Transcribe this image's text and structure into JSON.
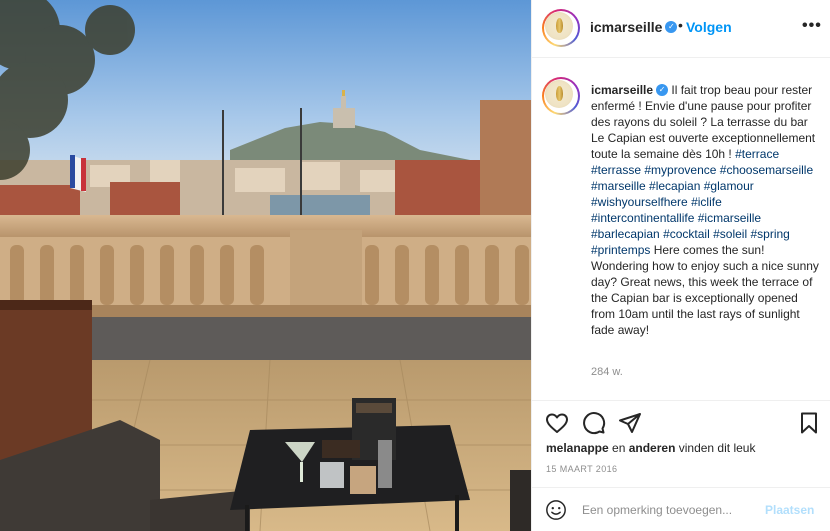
{
  "post": {
    "username": "icmarseille",
    "verified": true,
    "follow_separator": "•",
    "follow_label": "Volgen",
    "more_label": "•••"
  },
  "caption": {
    "username": "icmarseille",
    "segments": [
      {
        "type": "text",
        "value": " Il fait trop beau pour rester enfermé ! Envie d'une pause pour profiter des rayons du soleil ? La terrasse du bar Le Capian est ouverte exceptionnellement toute la semaine dès 10h ! "
      },
      {
        "type": "tag",
        "value": "#terrace"
      },
      {
        "type": "text",
        "value": " "
      },
      {
        "type": "tag",
        "value": "#terrasse"
      },
      {
        "type": "text",
        "value": " "
      },
      {
        "type": "tag",
        "value": "#myprovence"
      },
      {
        "type": "text",
        "value": " "
      },
      {
        "type": "tag",
        "value": "#choosemarseille"
      },
      {
        "type": "text",
        "value": " "
      },
      {
        "type": "tag",
        "value": "#marseille"
      },
      {
        "type": "text",
        "value": " "
      },
      {
        "type": "tag",
        "value": "#lecapian"
      },
      {
        "type": "text",
        "value": " "
      },
      {
        "type": "tag",
        "value": "#glamour"
      },
      {
        "type": "text",
        "value": " "
      },
      {
        "type": "tag",
        "value": "#wishyourselfhere"
      },
      {
        "type": "text",
        "value": " "
      },
      {
        "type": "tag",
        "value": "#iclife"
      },
      {
        "type": "text",
        "value": " "
      },
      {
        "type": "tag",
        "value": "#intercontinentallife"
      },
      {
        "type": "text",
        "value": " "
      },
      {
        "type": "tag",
        "value": "#icmarseille"
      },
      {
        "type": "text",
        "value": " "
      },
      {
        "type": "tag",
        "value": "#barlecapian"
      },
      {
        "type": "text",
        "value": " "
      },
      {
        "type": "tag",
        "value": "#cocktail"
      },
      {
        "type": "text",
        "value": " "
      },
      {
        "type": "tag",
        "value": "#soleil"
      },
      {
        "type": "text",
        "value": " "
      },
      {
        "type": "tag",
        "value": "#spring"
      },
      {
        "type": "text",
        "value": " "
      },
      {
        "type": "tag",
        "value": "#printemps"
      },
      {
        "type": "text",
        "value": " Here comes the sun! Wondering how to enjoy such a nice sunny day? Great news, this week the terrace of the Capian bar is exceptionally opened from 10am until the last rays of sunlight fade away!"
      }
    ],
    "age": "284 w."
  },
  "actions": {
    "icons": [
      "heart-icon",
      "comment-icon",
      "share-icon",
      "bookmark-icon"
    ]
  },
  "likes": {
    "user": "melanappe",
    "middle": " en ",
    "others": "anderen",
    "suffix": " vinden dit leuk"
  },
  "date": "15 MAART 2016",
  "comment_box": {
    "placeholder": "Een opmerking toevoegen...",
    "post_label": "Plaatsen",
    "emoji_icon": "smiley-icon"
  },
  "colors": {
    "link_blue": "#0095f6",
    "hashtag": "#00376b",
    "post_disabled": "#b2dffc",
    "muted": "#8e8e8e",
    "verified": "#3897f0"
  }
}
